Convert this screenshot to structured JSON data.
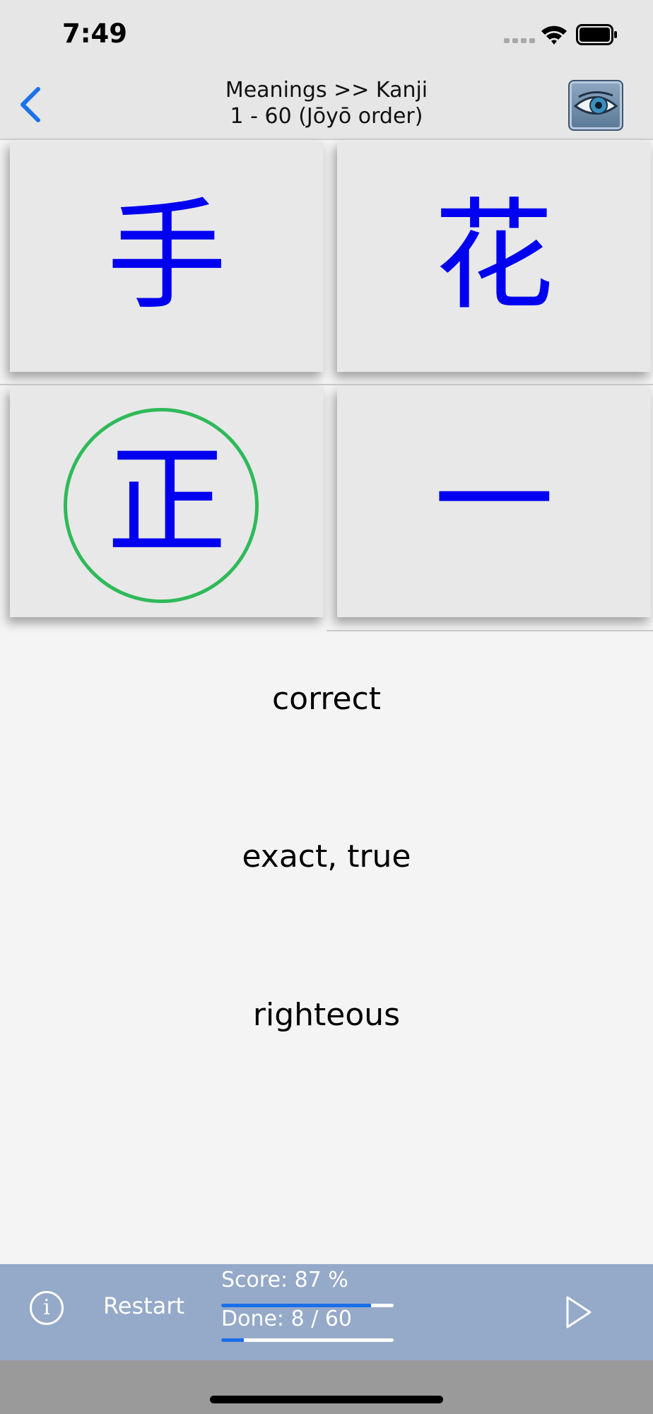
{
  "status_bar": {
    "time": "7:49",
    "signal_icon": "cellular-signal-icon",
    "wifi_icon": "wifi-icon",
    "battery_icon": "battery-icon"
  },
  "nav": {
    "back_icon": "chevron-left-icon",
    "title_line1": "Meanings >> Kanji",
    "title_line2": "1 - 60 (Jōyō order)",
    "reveal_icon": "eye-icon",
    "accent_color": "#1a73e8"
  },
  "answers": [
    {
      "kanji": "手",
      "selected": false
    },
    {
      "kanji": "花",
      "selected": false
    },
    {
      "kanji": "正",
      "selected": true
    },
    {
      "kanji": "一",
      "selected": false
    }
  ],
  "colors": {
    "kanji": "#0000f0",
    "selection_circle": "#2fba5a",
    "toolbar": "#95a9c9"
  },
  "meanings": [
    "correct",
    "exact, true",
    "righteous"
  ],
  "toolbar": {
    "info_icon": "info-icon",
    "info_glyph": "i",
    "restart_label": "Restart",
    "score_label": "Score:  87 %",
    "score_fraction": 0.87,
    "done_label": "Done:  8 / 60",
    "done_fraction": 0.133,
    "play_icon": "play-icon"
  }
}
